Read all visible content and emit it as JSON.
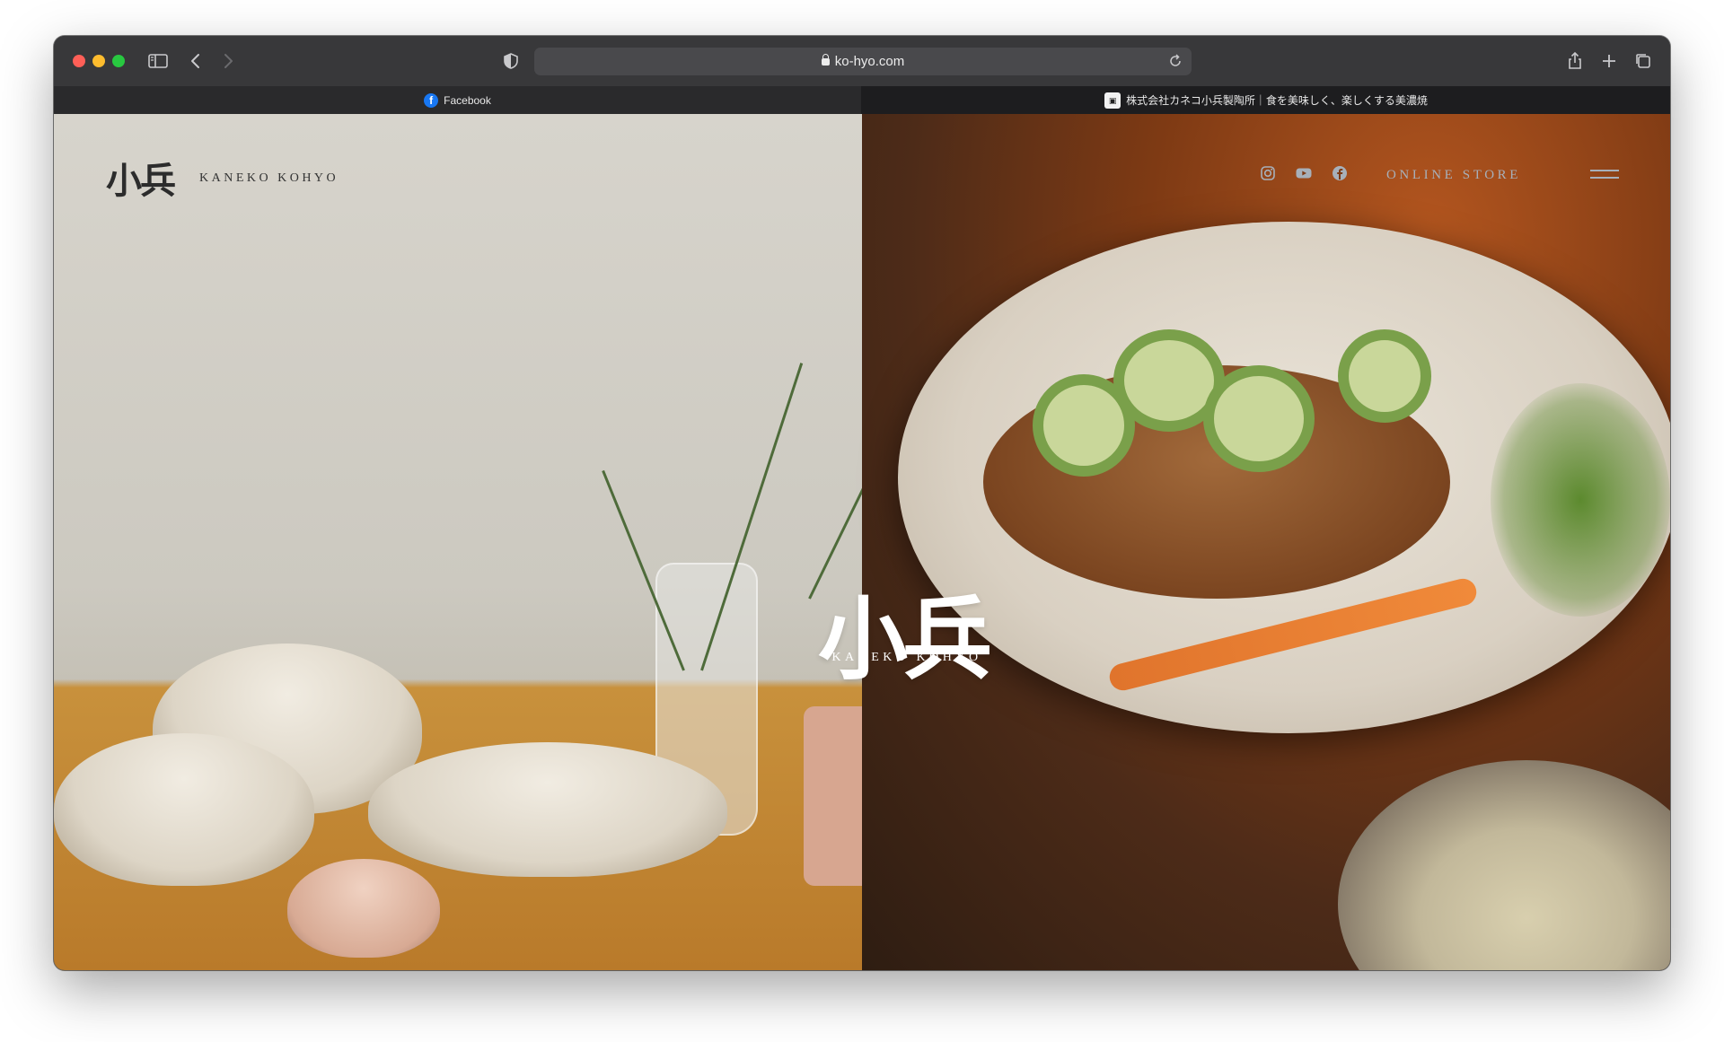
{
  "browser": {
    "url": "ko-hyo.com",
    "tabs": [
      {
        "label": "Facebook",
        "favicon": "facebook-icon",
        "active": false
      },
      {
        "label": "株式会社カネコ小兵製陶所｜食を美味しく、楽しくする美濃焼",
        "favicon": "kaneko-kohyo-favicon",
        "active": true
      }
    ]
  },
  "site": {
    "logo_mark": "小兵",
    "brand_name": "KANEKO KOHYO",
    "center_logo_mark": "小兵",
    "center_brand_name": "KANEKO KOHYO",
    "online_store_label": "ONLINE STORE",
    "social_icons": [
      "instagram-icon",
      "youtube-icon",
      "facebook-icon"
    ]
  },
  "colors": {
    "nav_text": "#a7b0ba",
    "logo_dark": "#2c2c2c"
  }
}
